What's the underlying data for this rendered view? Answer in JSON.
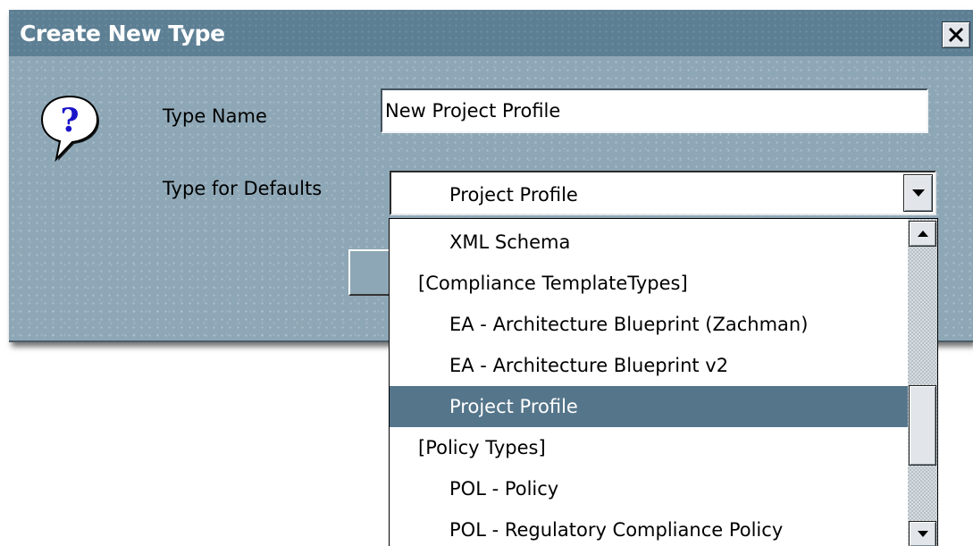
{
  "dialog": {
    "title": "Create New Type",
    "close_icon": "close-icon",
    "question_icon": "question-icon",
    "type_name_label": "Type Name",
    "type_name_value": "New Project Profile",
    "type_for_defaults_label": "Type for Defaults",
    "type_for_defaults_value": "Project Profile"
  },
  "dropdown": {
    "items": [
      {
        "label": "XML Schema",
        "kind": "child"
      },
      {
        "label": "[Compliance TemplateTypes]",
        "kind": "group"
      },
      {
        "label": "EA - Architecture Blueprint (Zachman)",
        "kind": "child"
      },
      {
        "label": "EA - Architecture Blueprint v2",
        "kind": "child"
      },
      {
        "label": "Project Profile",
        "kind": "child",
        "selected": true
      },
      {
        "label": "[Policy Types]",
        "kind": "group"
      },
      {
        "label": "POL - Policy",
        "kind": "child"
      },
      {
        "label": "POL - Regulatory Compliance Policy",
        "kind": "child"
      }
    ],
    "scroll_position": 0.72
  },
  "colors": {
    "title_bar": "#5d7f94",
    "dialog_body": "#8ea7b6",
    "selection": "#55758a"
  }
}
